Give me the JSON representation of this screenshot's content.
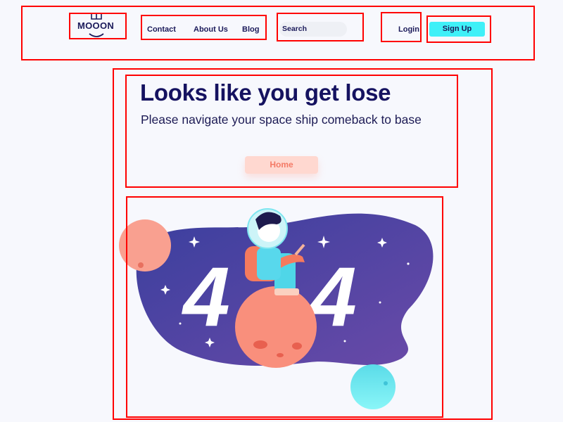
{
  "header": {
    "logo": "MOOON",
    "nav": [
      {
        "label": "Contact"
      },
      {
        "label": "About Us"
      },
      {
        "label": "Blog"
      }
    ],
    "search": {
      "placeholder": "Search"
    },
    "login_label": "Login",
    "signup_label": "Sign Up"
  },
  "main": {
    "title": "Looks like you get lose",
    "subtitle": "Please navigate your space ship comeback to base",
    "home_label": "Home",
    "illustration": {
      "digits": [
        "4",
        "4"
      ],
      "colors": {
        "blob": "#5a4aa8",
        "planet": "#f98f7c",
        "moon": "#6ee8f0"
      }
    }
  },
  "colors": {
    "accent": "#3ff0f8",
    "text": "#151260",
    "home_bg": "#ffd8d0",
    "home_text": "#f47a66"
  }
}
